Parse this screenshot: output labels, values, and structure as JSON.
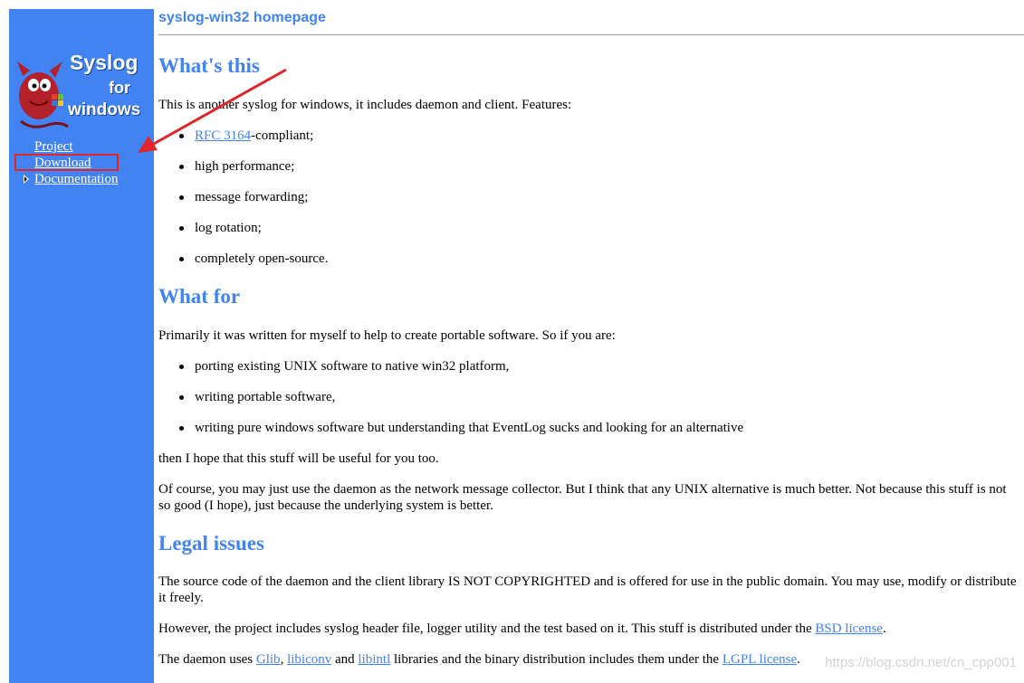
{
  "sidebar": {
    "logo": {
      "line1": "Syslog",
      "line2": "for",
      "line3": "windows"
    },
    "nav": [
      {
        "label": "Project"
      },
      {
        "label": "Download"
      },
      {
        "label": "Documentation"
      }
    ]
  },
  "header": {
    "title": "syslog-win32 homepage"
  },
  "sections": {
    "whats_this": {
      "heading": "What's this",
      "intro": "This is another syslog for windows, it includes daemon and client. Features:",
      "rfc_link": "RFC 3164",
      "rfc_suffix": "-compliant;",
      "items": [
        "high performance;",
        "message forwarding;",
        "log rotation;",
        "completely open-source."
      ]
    },
    "what_for": {
      "heading": "What for",
      "intro": "Primarily it was written for myself to help to create portable software. So if you are:",
      "items": [
        "porting existing UNIX software to native win32 platform,",
        "writing portable software,",
        "writing pure windows software but understanding that EventLog sucks and looking for an alternative"
      ],
      "after": "then I hope that this stuff will be useful for you too.",
      "para": "Of course, you may just use the daemon as the network message collector. But I think that any UNIX alternative is much better. Not because this stuff is not so good (I hope), just because the underlying system is better."
    },
    "legal": {
      "heading": "Legal issues",
      "para1": "The source code of the daemon and the client library IS NOT COPYRIGHTED and is offered for use in the public domain. You may use, modify or distribute it freely.",
      "para2_pre": "However, the project includes syslog header file, logger utility and the test based on it. This stuff is distributed under the ",
      "para2_link": "BSD license",
      "para2_post": ".",
      "para3_pre": "The daemon uses ",
      "glib": "Glib",
      "sep1": ", ",
      "libiconv": "libiconv",
      "sep2": " and ",
      "libintl": "libintl",
      "para3_mid": " libraries and the binary distribution includes them under the ",
      "lgpl": "LGPL license",
      "para3_post": "."
    }
  },
  "watermark": "https://blog.csdn.net/cn_cpp001",
  "colors": {
    "accent": "#4283f4",
    "annotation": "#e0262b"
  }
}
